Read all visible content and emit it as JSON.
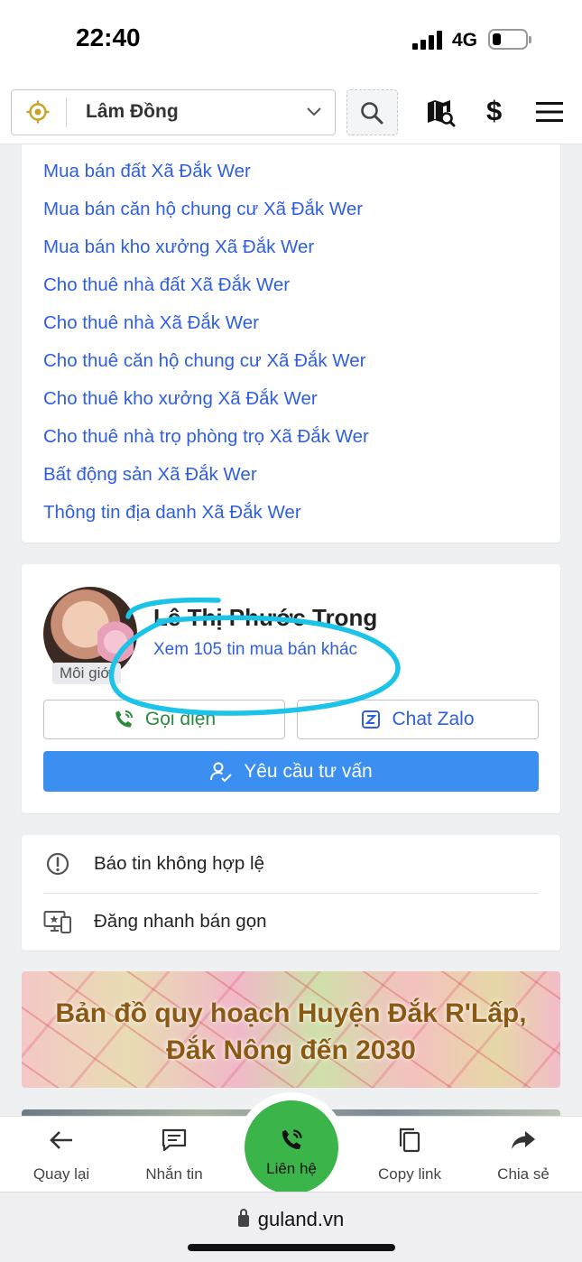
{
  "status_bar": {
    "time": "22:40",
    "network": "4G"
  },
  "header": {
    "location": "Lâm Đồng",
    "icons": [
      "location-target-icon",
      "chevron-down-icon",
      "search-icon",
      "map-search-icon",
      "dollar-icon",
      "menu-icon"
    ]
  },
  "links": [
    "Mua bán đất Xã Đắk Wer",
    "Mua bán căn hộ chung cư Xã Đắk Wer",
    "Mua bán kho xưởng Xã Đắk Wer",
    "Cho thuê nhà đất Xã Đắk Wer",
    "Cho thuê nhà Xã Đắk Wer",
    "Cho thuê căn hộ chung cư Xã Đắk Wer",
    "Cho thuê kho xưởng Xã Đắk Wer",
    "Cho thuê nhà trọ phòng trọ Xã Đắk Wer",
    "Bất động sản Xã Đắk Wer",
    "Thông tin địa danh Xã Đắk Wer"
  ],
  "agent": {
    "name": "Lê Thị Phước Trọng",
    "role": "Môi giới",
    "more_listings": "Xem 105 tin mua bán khác",
    "call_label": "Gọi điện",
    "zalo_label": "Chat Zalo",
    "consult_label": "Yêu cầu tư vấn",
    "annotation_color": "#1cc3e8"
  },
  "actions": {
    "report_label": "Báo tin không hợp lệ",
    "quick_post_label": "Đăng nhanh bán gọn"
  },
  "banner": {
    "line1": "Bản đồ quy hoạch Huyện Đắk R'Lấp,",
    "line2": "Đắk Nông đến 2030"
  },
  "bottom_nav": {
    "back": "Quay lại",
    "message": "Nhắn tin",
    "contact": "Liên hệ",
    "copy": "Copy link",
    "share": "Chia sẻ"
  },
  "browser": {
    "url": "guland.vn"
  },
  "colors": {
    "link": "#2f5fe0",
    "primary": "#3b8ff0",
    "call_green": "#3bb54a",
    "banner_text": "#8a5a12"
  }
}
